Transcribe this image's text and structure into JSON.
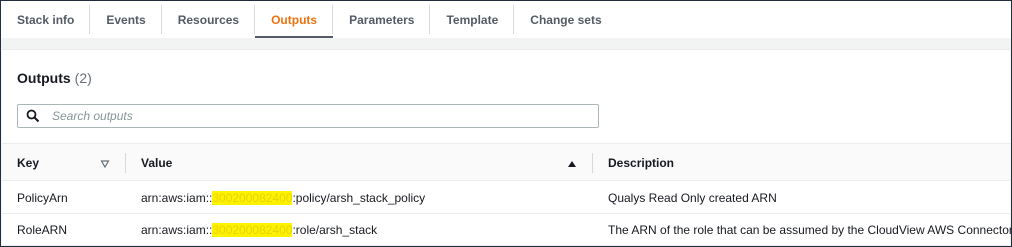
{
  "tabs": [
    {
      "label": "Stack info"
    },
    {
      "label": "Events"
    },
    {
      "label": "Resources"
    },
    {
      "label": "Outputs",
      "active": true
    },
    {
      "label": "Parameters"
    },
    {
      "label": "Template"
    },
    {
      "label": "Change sets"
    }
  ],
  "outputs": {
    "title": "Outputs",
    "count": "(2)",
    "search_placeholder": "Search outputs",
    "columns": {
      "key": "Key",
      "value": "Value",
      "description": "Description"
    },
    "sort": {
      "column": "Value",
      "direction": "ascending"
    },
    "rows": [
      {
        "key": "PolicyArn",
        "value_prefix": "arn:aws:iam::",
        "value_account": "300200082400",
        "value_suffix": ":policy/arsh_stack_policy",
        "description": "Qualys Read Only created ARN"
      },
      {
        "key": "RoleARN",
        "value_prefix": "arn:aws:iam::",
        "value_account": "300200082400",
        "value_suffix": ":role/arsh_stack",
        "description": "The ARN of the role that can be assumed by the CloudView AWS Connector."
      }
    ]
  },
  "colors": {
    "active_tab": "#ec7211",
    "highlight": "#fff200",
    "border": "#232f3e"
  }
}
